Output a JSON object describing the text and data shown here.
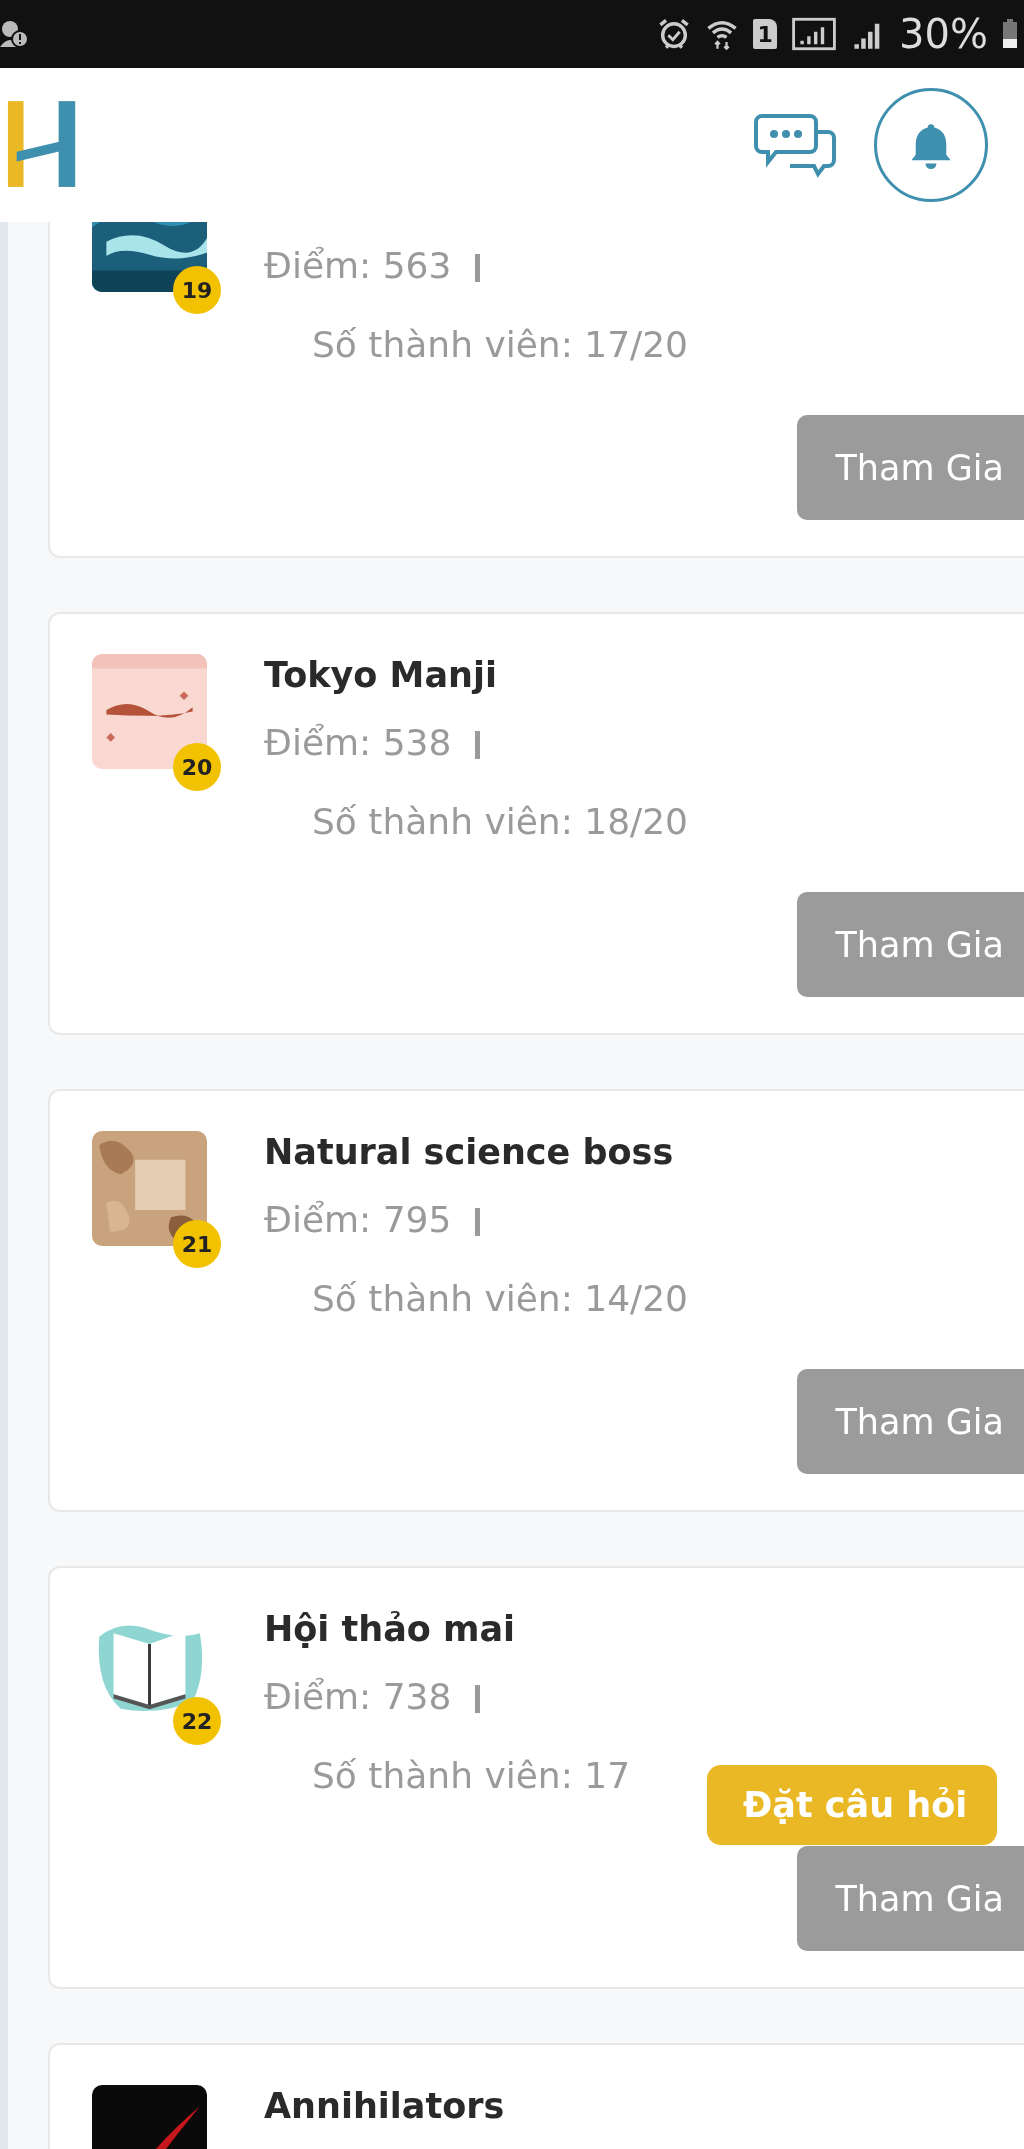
{
  "status_bar": {
    "sim_slot": "1",
    "battery": "30%"
  },
  "groups": [
    {
      "rank": "19",
      "score": "Điểm: 563",
      "members": "Số thành viên: 17/20",
      "button": "Tham Gia"
    },
    {
      "rank": "20",
      "name": "Tokyo Manji",
      "score": "Điểm: 538",
      "members": "Số thành viên: 18/20",
      "button": "Tham Gia"
    },
    {
      "rank": "21",
      "name": "Natural science boss",
      "score": "Điểm: 795",
      "members": "Số thành viên: 14/20",
      "button": "Tham Gia"
    },
    {
      "rank": "22",
      "name": "Hội thảo mai",
      "score": "Điểm: 738",
      "members": "Số thành viên: 17",
      "button": "Tham Gia",
      "tooltip": "Đặt câu hỏi"
    },
    {
      "name": "Annihilators"
    }
  ]
}
